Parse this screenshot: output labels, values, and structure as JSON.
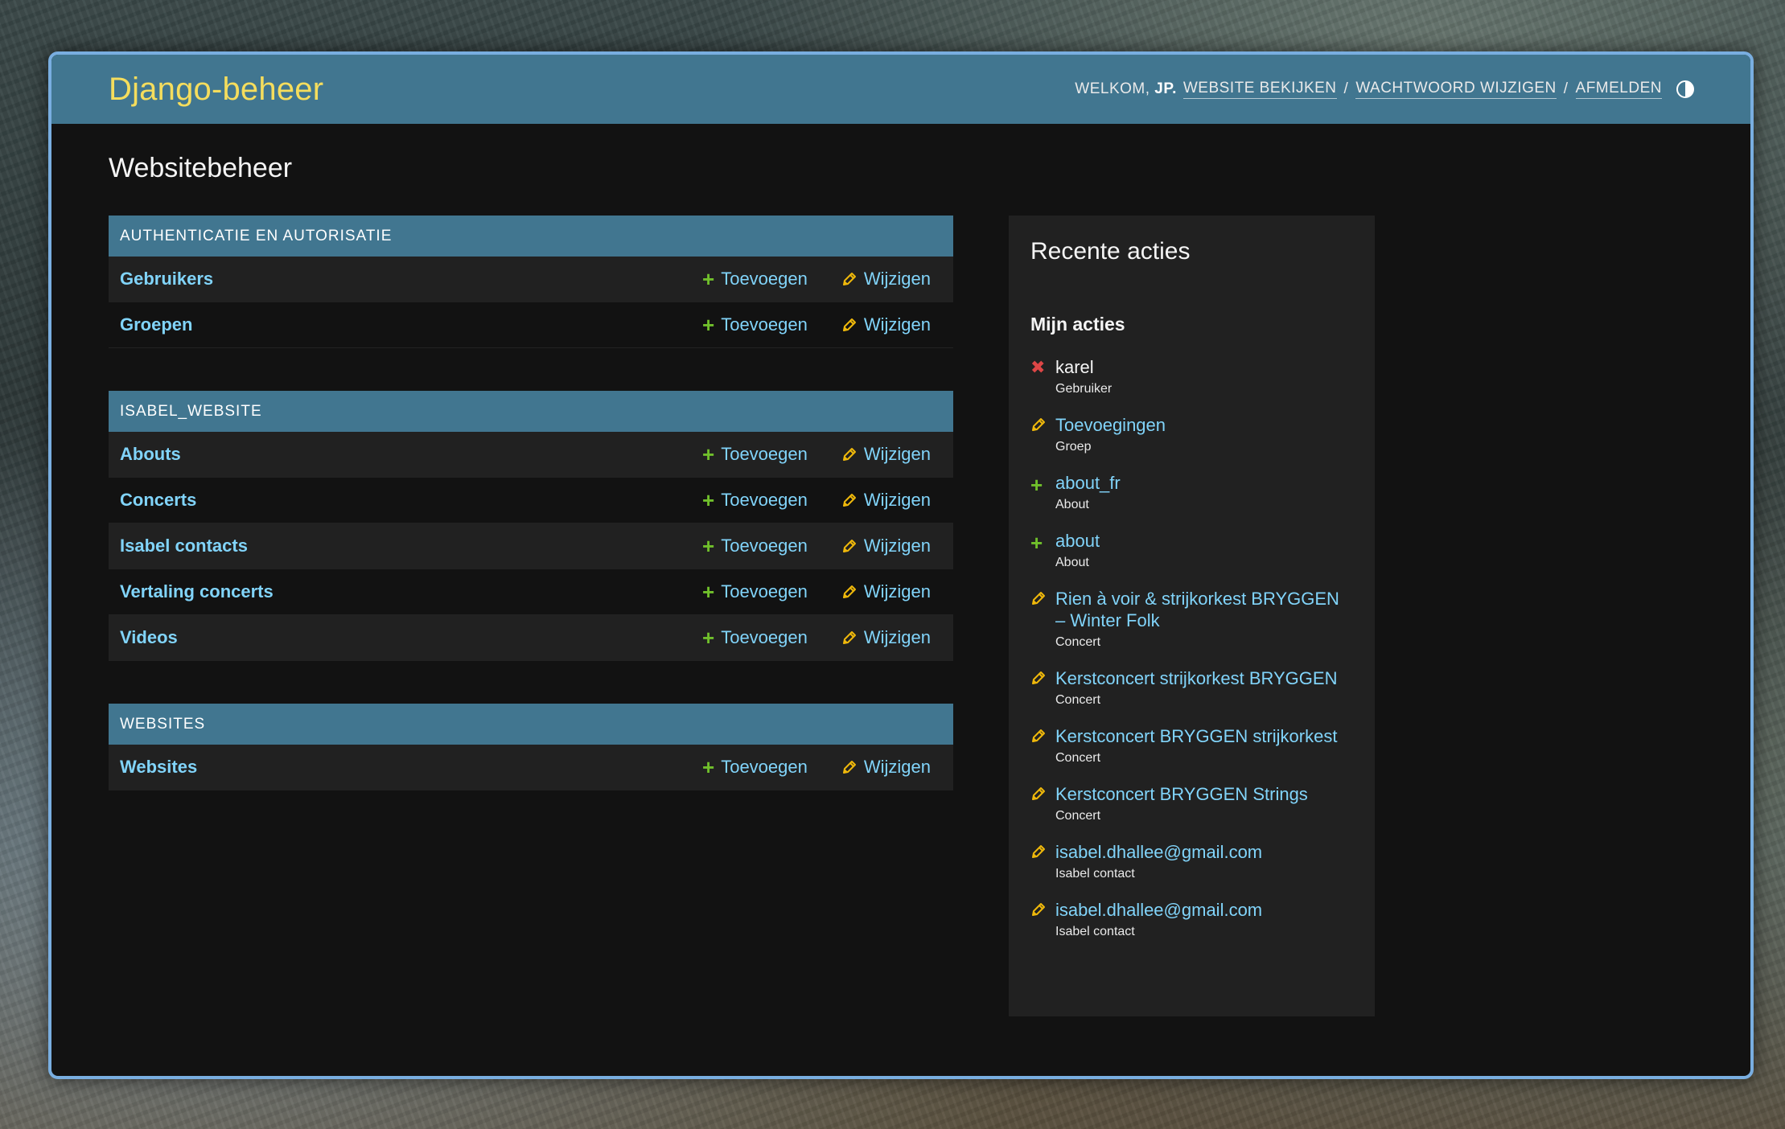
{
  "header": {
    "brand": "Django-beheer",
    "welcome": "WELKOM,",
    "username": "JP.",
    "view_site": "WEBSITE BEKIJKEN",
    "change_password": "WACHTWOORD WIJZIGEN",
    "logout": "AFMELDEN",
    "separator": "/"
  },
  "page_title": "Websitebeheer",
  "modules": [
    {
      "caption": "AUTHENTICATIE EN AUTORISATIE",
      "models": [
        {
          "name": "Gebruikers",
          "add": "Toevoegen",
          "change": "Wijzigen"
        },
        {
          "name": "Groepen",
          "add": "Toevoegen",
          "change": "Wijzigen"
        }
      ]
    },
    {
      "caption": "ISABEL_WEBSITE",
      "models": [
        {
          "name": "Abouts",
          "add": "Toevoegen",
          "change": "Wijzigen"
        },
        {
          "name": "Concerts",
          "add": "Toevoegen",
          "change": "Wijzigen"
        },
        {
          "name": "Isabel contacts",
          "add": "Toevoegen",
          "change": "Wijzigen"
        },
        {
          "name": "Vertaling concerts",
          "add": "Toevoegen",
          "change": "Wijzigen"
        },
        {
          "name": "Videos",
          "add": "Toevoegen",
          "change": "Wijzigen"
        }
      ]
    },
    {
      "caption": "WEBSITES",
      "models": [
        {
          "name": "Websites",
          "add": "Toevoegen",
          "change": "Wijzigen"
        }
      ]
    }
  ],
  "recent": {
    "title": "Recente acties",
    "subtitle": "Mijn acties",
    "actions": [
      {
        "kind": "delete",
        "icon": "delete-icon",
        "title": "karel",
        "type": "Gebruiker"
      },
      {
        "kind": "change",
        "icon": "pencil-icon",
        "title": "Toevoegingen",
        "type": "Groep"
      },
      {
        "kind": "add",
        "icon": "plus-icon",
        "title": "about_fr",
        "type": "About"
      },
      {
        "kind": "add",
        "icon": "plus-icon",
        "title": "about",
        "type": "About"
      },
      {
        "kind": "change",
        "icon": "pencil-icon",
        "title": "Rien à voir & strijkorkest BRYGGEN – Winter Folk",
        "type": "Concert"
      },
      {
        "kind": "change",
        "icon": "pencil-icon",
        "title": "Kerstconcert strijkorkest BRYGGEN",
        "type": "Concert"
      },
      {
        "kind": "change",
        "icon": "pencil-icon",
        "title": "Kerstconcert BRYGGEN strijkorkest",
        "type": "Concert"
      },
      {
        "kind": "change",
        "icon": "pencil-icon",
        "title": "Kerstconcert BRYGGEN Strings",
        "type": "Concert"
      },
      {
        "kind": "change",
        "icon": "pencil-icon",
        "title": "isabel.dhallee@gmail.com",
        "type": "Isabel contact"
      },
      {
        "kind": "change",
        "icon": "pencil-icon",
        "title": "isabel.dhallee@gmail.com",
        "type": "Isabel contact"
      }
    ]
  },
  "colors": {
    "header_bg": "#417690",
    "brand": "#f5dd5d",
    "link": "#81d4fa",
    "add_green": "#70bf2b",
    "change_yellow": "#efb80b",
    "delete_red": "#dd4646",
    "window_border": "#79aee0"
  }
}
